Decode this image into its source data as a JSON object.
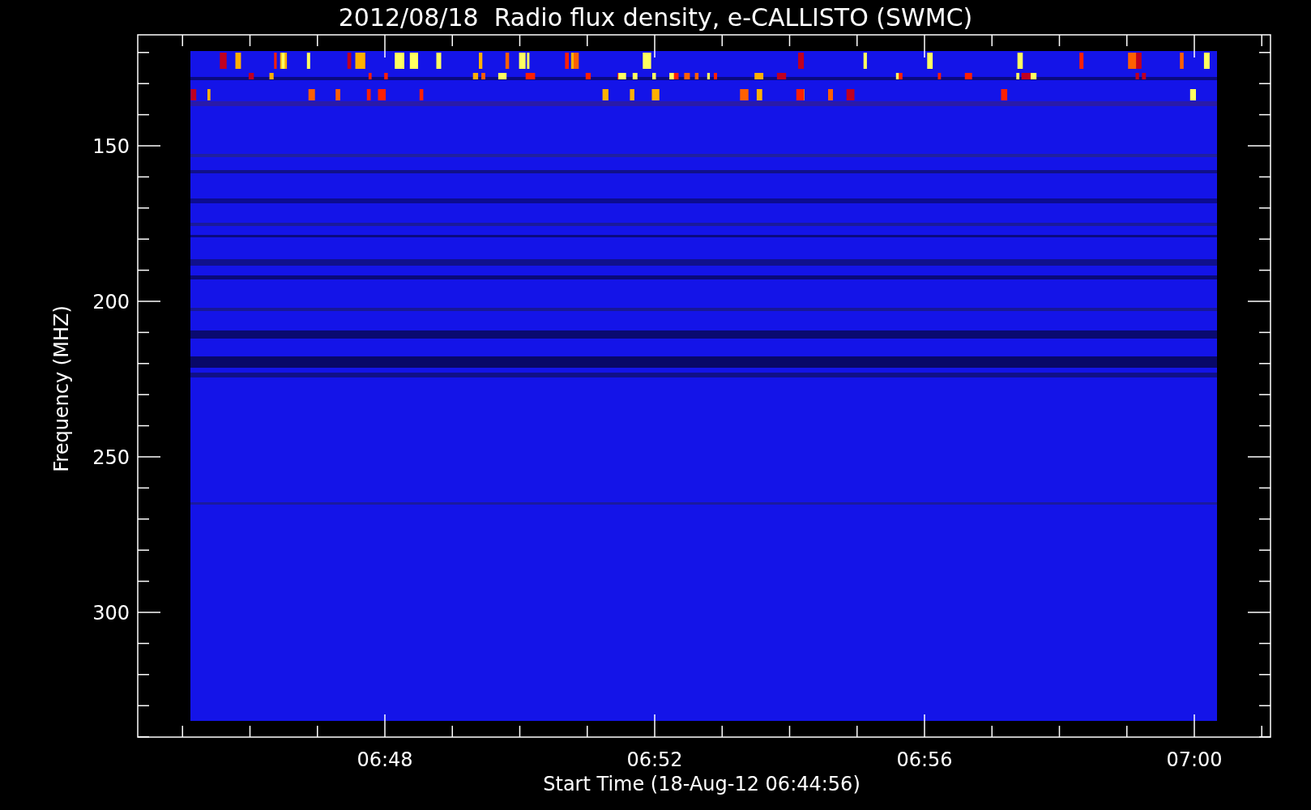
{
  "chart": {
    "title": "2012/08/18  Radio flux density, e-CALLISTO (SWMC)",
    "y_axis": {
      "label": "Frequency (MHZ)",
      "ticks": [
        "150",
        "200",
        "250",
        "300"
      ]
    },
    "x_axis": {
      "label": "Start Time (18-Aug-12 06:44:56)",
      "ticks": [
        "06:48",
        "06:52",
        "06:56",
        "07:00"
      ]
    }
  }
}
